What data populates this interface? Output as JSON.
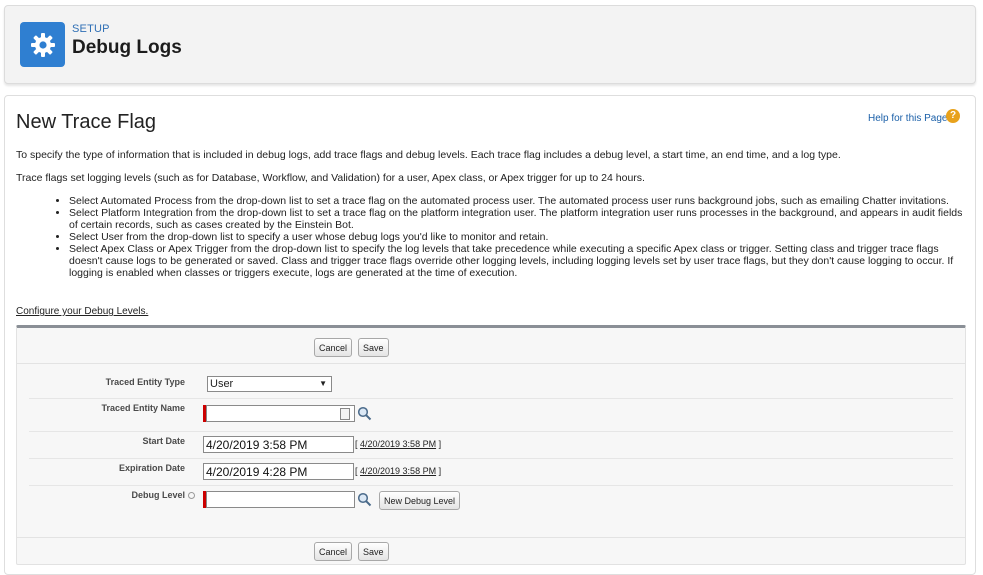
{
  "header": {
    "eyebrow": "SETUP",
    "title": "Debug Logs",
    "icon": "gear-icon",
    "accent": "#2f7fd1"
  },
  "main": {
    "title": "New Trace Flag",
    "help_link": "Help for this Page",
    "intro_1": "To specify the type of information that is included in debug logs, add trace flags and debug levels. Each trace flag includes a debug level, a start time, an end time, and a log type.",
    "intro_2": "Trace flags set logging levels (such as for Database, Workflow, and Validation) for a user, Apex class, or Apex trigger for up to 24 hours.",
    "bullets": [
      "Select Automated Process from the drop-down list to set a trace flag on the automated process user. The automated process user runs background jobs, such as emailing Chatter invitations.",
      "Select Platform Integration from the drop-down list to set a trace flag on the platform integration user. The platform integration user runs processes in the background, and appears in audit fields of certain records, such as cases created by the Einstein Bot.",
      "Select User from the drop-down list to specify a user whose debug logs you'd like to monitor and retain.",
      "Select Apex Class or Apex Trigger from the drop-down list to specify the log levels that take precedence while executing a specific Apex class or trigger. Setting class and trigger trace flags doesn't cause logs to be generated or saved. Class and trigger trace flags override other logging levels, including logging levels set by user trace flags, but they don't cause logging to occur. If logging is enabled when classes or triggers execute, logs are generated at the time of execution."
    ],
    "config_link": "Configure your Debug Levels."
  },
  "form": {
    "cancel_label": "Cancel",
    "save_label": "Save",
    "traced_entity_type": {
      "label": "Traced Entity Type",
      "value": "User"
    },
    "traced_entity_name": {
      "label": "Traced Entity Name",
      "value": ""
    },
    "start_date": {
      "label": "Start Date",
      "value": "4/20/2019 3:58 PM",
      "link": "4/20/2019 3:58 PM"
    },
    "expiration_date": {
      "label": "Expiration Date",
      "value": "4/20/2019 4:28 PM",
      "link": "4/20/2019 3:58 PM"
    },
    "debug_level": {
      "label": "Debug Level",
      "value": "",
      "new_button": "New Debug Level"
    },
    "required_color": "#cc0000"
  }
}
